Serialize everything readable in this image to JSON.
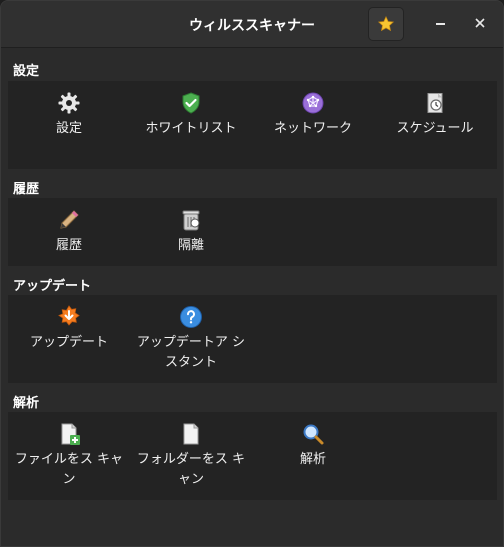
{
  "window": {
    "title": "ウィルススキャナー",
    "star_icon": "star-icon",
    "minimize_icon": "minimize-icon",
    "close_icon": "close-icon"
  },
  "sections": {
    "settings": {
      "title": "設定",
      "items": [
        {
          "label": "設定",
          "icon": "gear-icon"
        },
        {
          "label": "ホワイトリスト",
          "icon": "shield-check-icon"
        },
        {
          "label": "ネットワーク",
          "icon": "network-icon"
        },
        {
          "label": "スケジュール",
          "icon": "schedule-icon"
        }
      ]
    },
    "history": {
      "title": "履歴",
      "items": [
        {
          "label": "履歴",
          "icon": "pencil-icon"
        },
        {
          "label": "隔離",
          "icon": "quarantine-bin-icon"
        }
      ]
    },
    "update": {
      "title": "アップデート",
      "items": [
        {
          "label": "アップデート",
          "icon": "update-download-icon"
        },
        {
          "label": "アップデートア シスタント",
          "icon": "help-icon"
        }
      ]
    },
    "analysis": {
      "title": "解析",
      "items": [
        {
          "label": "ファイルをス キャン",
          "icon": "file-add-icon"
        },
        {
          "label": "フォルダーをス キャン",
          "icon": "document-icon"
        },
        {
          "label": "解析",
          "icon": "magnifier-icon"
        }
      ]
    }
  },
  "colors": {
    "window_bg": "#2b2b2b",
    "panel_bg": "#232323",
    "titlebar_bg": "#303030",
    "text": "#ffffff"
  }
}
